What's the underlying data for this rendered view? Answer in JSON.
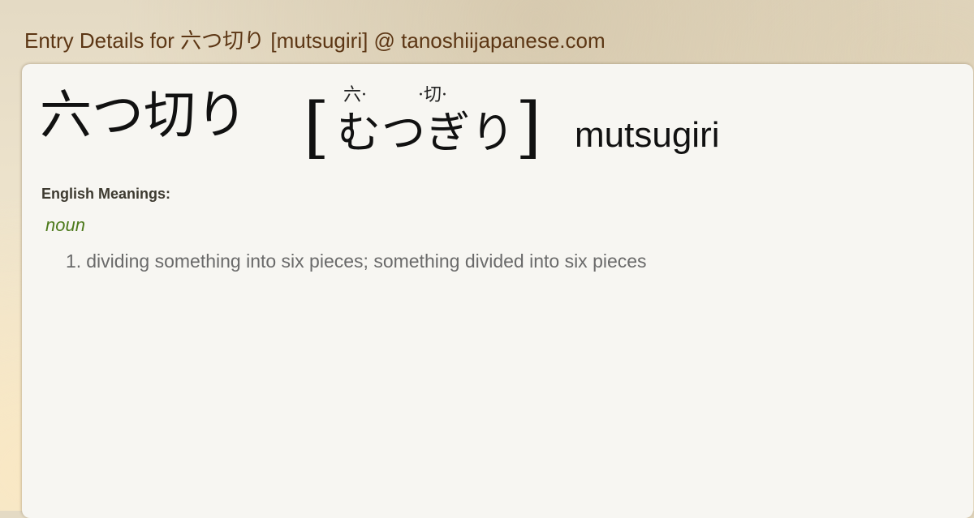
{
  "header": {
    "title": "Entry Details for 六つ切り [mutsugiri] @ tanoshiijapanese.com"
  },
  "entry": {
    "kanji": "六つ切り",
    "bracket_open": "[",
    "bracket_close": "]",
    "furigana": [
      "六·",
      "·切·"
    ],
    "kana": "むつぎり",
    "romaji": "mutsugiri"
  },
  "meanings": {
    "label": "English Meanings:",
    "part_of_speech": "noun",
    "senses": [
      {
        "number": "1.",
        "text": "dividing something into six pieces; something divided into six pieces"
      }
    ]
  }
}
